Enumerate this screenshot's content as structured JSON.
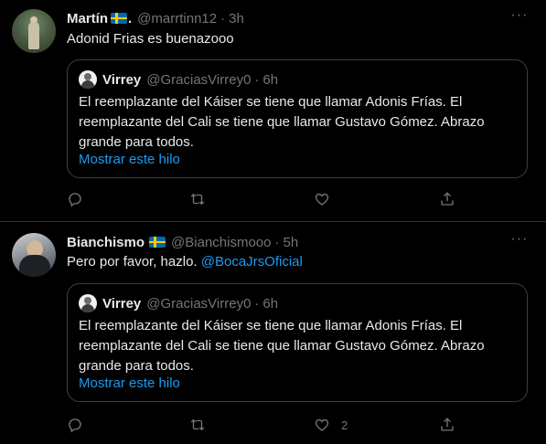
{
  "tweets": [
    {
      "name": "Martín",
      "name_suffix": ".",
      "handle": "@marrtinn12",
      "separator": "·",
      "time": "3h",
      "text_parts": [
        "Adonid Frias es buenazooo"
      ],
      "quote": {
        "name": "Virrey",
        "handle": "@GraciasVirrey0",
        "separator": "·",
        "time": "6h",
        "text_lines": [
          "El reemplazante del Káiser se tiene que llamar Adonis Frías. El",
          "reemplazante del Cali se tiene que llamar Gustavo Gómez. Abrazo",
          "grande para todos."
        ],
        "thread_link": "Mostrar este hilo"
      },
      "actions": {
        "reply_count": "",
        "retweet_count": "",
        "like_count": "",
        "more_icon": "more-dots-icon"
      }
    },
    {
      "name": "Bianchismo",
      "name_suffix": "",
      "handle": "@Bianchismooo",
      "separator": "·",
      "time": "5h",
      "text_plain": "Pero por favor, hazlo. ",
      "mention": "@BocaJrsOficial",
      "quote": {
        "name": "Virrey",
        "handle": "@GraciasVirrey0",
        "separator": "·",
        "time": "6h",
        "text_lines": [
          "El reemplazante del Káiser se tiene que llamar Adonis Frías. El",
          "reemplazante del Cali se tiene que llamar Gustavo Gómez. Abrazo",
          "grande para todos."
        ],
        "thread_link": "Mostrar este hilo"
      },
      "actions": {
        "reply_count": "",
        "retweet_count": "",
        "like_count": "2",
        "more_icon": "more-dots-icon"
      }
    }
  ],
  "icons": {
    "reply": "reply-icon",
    "retweet": "retweet-icon",
    "like": "heart-icon",
    "share": "share-icon",
    "flag": "sweden-flag-icon"
  },
  "colors": {
    "background": "#000000",
    "text": "#e7e9ea",
    "secondary": "#71767b",
    "accent": "#1d9bf0",
    "border": "#2f3336"
  }
}
